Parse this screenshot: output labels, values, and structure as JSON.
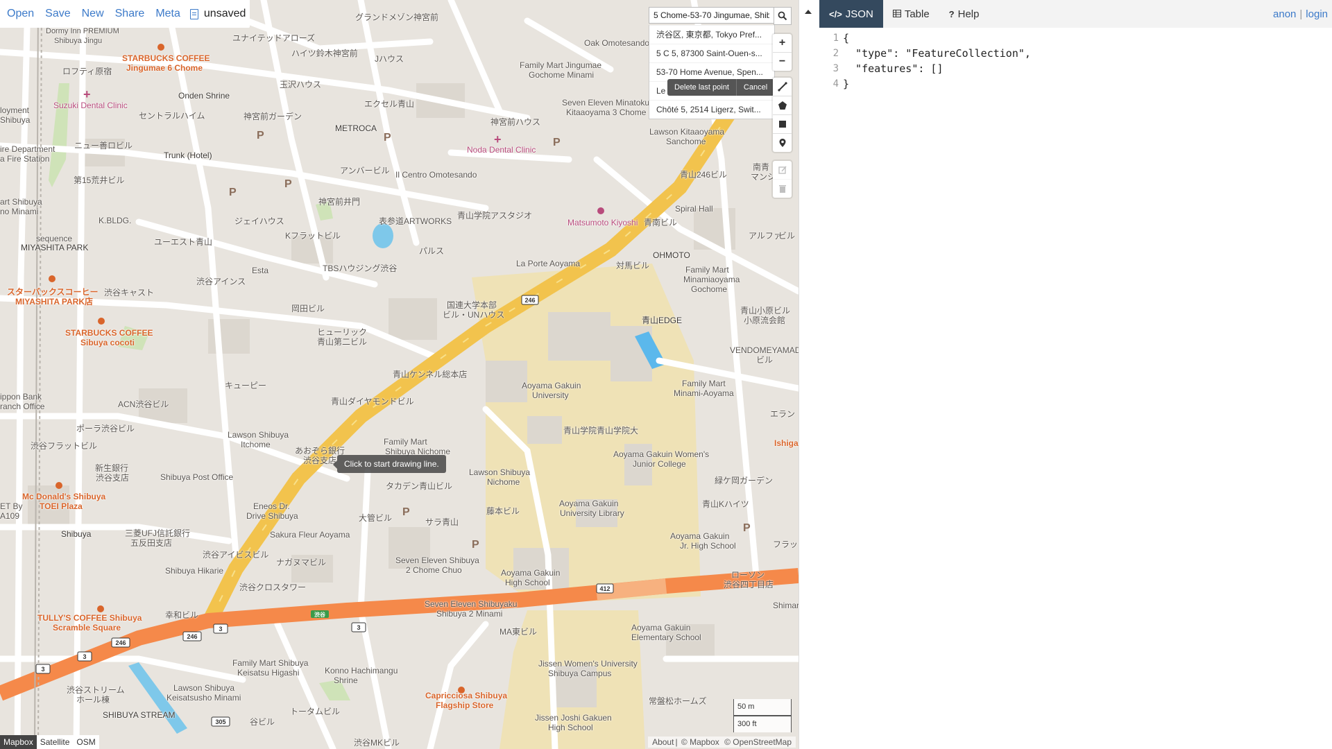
{
  "menu": {
    "items": [
      "Open",
      "Save",
      "New",
      "Share",
      "Meta"
    ],
    "doc_name": "unsaved"
  },
  "geocoder": {
    "value": "5 Chome-53-70 Jingumae, Shib",
    "results": [
      "渋谷区, 東京都, Tokyo Pref...",
      "5 C 5, 87300 Saint-Ouen-s...",
      "53-70 Home Avenue, Spen...",
      "Le",
      "Chôté 5, 2514 Ligerz, Swit..."
    ],
    "search_icon": "search-icon"
  },
  "controls": {
    "zoom_in": "+",
    "zoom_out": "−",
    "draw_tools": [
      "line-icon",
      "polygon-icon",
      "rectangle-icon",
      "marker-icon"
    ],
    "edit_tools": [
      "edit-icon",
      "trash-icon"
    ]
  },
  "draw": {
    "delete_last": "Delete last point",
    "cancel": "Cancel",
    "tooltip": "Click to start drawing line."
  },
  "layers": {
    "items": [
      "Mapbox",
      "Satellite",
      "OSM"
    ],
    "active": "Mapbox"
  },
  "scale": {
    "metric": "50 m",
    "imperial": "300 ft"
  },
  "attribution": {
    "about": "About",
    "mapbox": "© Mapbox",
    "osm": "© OpenStreetMap"
  },
  "map_labels": [
    "Dormy Inn PREMIUM",
    "Shibuya Jingu",
    "STARBUCKS COFFEE",
    "Jingumae 6 Chome",
    "ユナイテッドアローズ",
    "グランドメゾン神宮前",
    "ハイツ鈴木神宮前",
    "Jハウス",
    "ロフティ原宿",
    "玉沢ハウス",
    "Onden Shrine",
    "Suzuki Dental Clinic",
    "セントラルハイム",
    "神宮前ガーデン",
    "エクセル青山",
    "METROCA",
    "神宮前ハウス",
    "Noda Dental Clinic",
    "Oak Omotesando",
    "Family Mart Jingumae",
    "Gochome Minami",
    "Seven Eleven Minatoku",
    "Kitaaoyama 3 Chome",
    "Lawson Kitaaoyama",
    "Sanchome",
    "ニュー善ロビル",
    "Trunk (Hotel)",
    "アンバービル",
    "Il Centro Omotesando",
    "第15荒井ビル",
    "神宮前井門",
    "表参道ARTWORKS",
    "青山学院アスタジオ",
    "Matsumoto Kiyoshi",
    "青南ビル",
    "Spiral Hall",
    "青山246ビル",
    "K.BLDG.",
    "ジェイハウス",
    "Kフラットビル",
    "パルス",
    "ユーエスト青山",
    "sequence",
    "MIYASHITA PARK",
    "Esta",
    "La Porte Aoyama",
    "対馬ビル",
    "OHMOTO",
    "Family Mart",
    "Minamiaoyama",
    "Gochome",
    "渋谷アインス",
    "TBSハウジング渋谷",
    "スターバックスコーヒー",
    "MIYASHITA PARK店",
    "渋谷キャスト",
    "岡田ビル",
    "国連大学本部",
    "ビル・UNハウス",
    "青山EDGE",
    "STARBUCKS COFFEE",
    "Sibuya cocoti",
    "ヒューリック",
    "青山第二ビル",
    "青山ケンネル総本店",
    "Aoyama Gakuin",
    "University",
    "VENDOMEYAMADA",
    "ビル",
    "キューピー",
    "Family Mart",
    "Minami-Aoyama",
    "ACN渋谷ビル",
    "青山ダイヤモンドビル",
    "ポーラ渋谷ビル",
    "Lawson Shibuya",
    "Itchome",
    "あおぞら銀行",
    "渋谷支店",
    "Family Mart",
    "Shibuya Nichome",
    "青山学院青山学院大",
    "Aoyama Gakuin Women's",
    "Junior College",
    "渋谷フラットビル",
    "新生銀行",
    "渋谷支店",
    "Shibuya Post Office",
    "Lawson Shibuya",
    "Nichome",
    "タカデン青山ビル",
    "緑ケ岡ガーデン",
    "Mc Donald's Shibuya",
    "TOEI Plaza",
    "Eneos Dr.",
    "Drive Shibuya",
    "大管ビル",
    "サラ青山",
    "藤本ビル",
    "Aoyama Gakuin",
    "University Library",
    "青山Kハイツ",
    "Shibuya",
    "三菱UFJ信託銀行",
    "五反田支店",
    "Sakura Fleur Aoyama",
    "Aoyama Gakuin",
    "Jr. High School",
    "渋谷アイビスビル",
    "ナガヌマビル",
    "Seven Eleven Shibuya",
    "2 Chome Chuo",
    "Aoyama Gakuin",
    "High School",
    "Shibuya Hikarie",
    "渋谷クロスタワー",
    "ローソン",
    "渋谷四丁目店",
    "TULLY'S COFFEE Shibuya",
    "Scramble Square",
    "幸和ビル",
    "Seven Eleven Shibuyaku",
    "Shibuya 2 Minami",
    "MA東ビル",
    "Aoyama Gakuin",
    "Elementary School",
    "Family Mart Shibuya",
    "Keisatsu Higashi",
    "Konno Hachimangu",
    "Shrine",
    "Jissen Women's University",
    "Shibuya Campus",
    "渋谷ストリーム",
    "ホール棟",
    "Lawson Shibuya",
    "Keisatsusho Minami",
    "Capricciosa Shibuya",
    "Flagship Store",
    "常盤松ホームズ",
    "SHIBUYA STREAM",
    "トータムビル",
    "Jissen Joshi Gakuen",
    "High School",
    "谷ビル",
    "渋谷MKビル",
    "ire Department",
    "a Fire Station",
    "loyment",
    "Shibuya",
    "art Shibuya",
    "no Minami",
    "ippon Bank",
    "ranch Office",
    "ET By",
    "A109",
    "南青",
    "マンシ",
    "アルファ",
    "ビル",
    "青山小原ビル",
    "小原流会館",
    "エラン",
    "Ishiga",
    "フラッ",
    "Shimar"
  ],
  "road_shields": [
    "246",
    "246",
    "412",
    "3",
    "3",
    "3",
    "305",
    "246",
    "3"
  ],
  "sidebar": {
    "tabs": [
      {
        "label": "JSON",
        "icon": "code-icon"
      },
      {
        "label": "Table",
        "icon": "table-icon"
      },
      {
        "label": "Help",
        "icon": "help-icon"
      }
    ],
    "active_tab": "JSON",
    "auth": {
      "anon": "anon",
      "sep": "|",
      "login": "login"
    },
    "editor": {
      "line_numbers": [
        "1",
        "2",
        "3",
        "4"
      ],
      "lines": [
        "{",
        "  \"type\": \"FeatureCollection\",",
        "  \"features\": []",
        "}"
      ]
    }
  }
}
